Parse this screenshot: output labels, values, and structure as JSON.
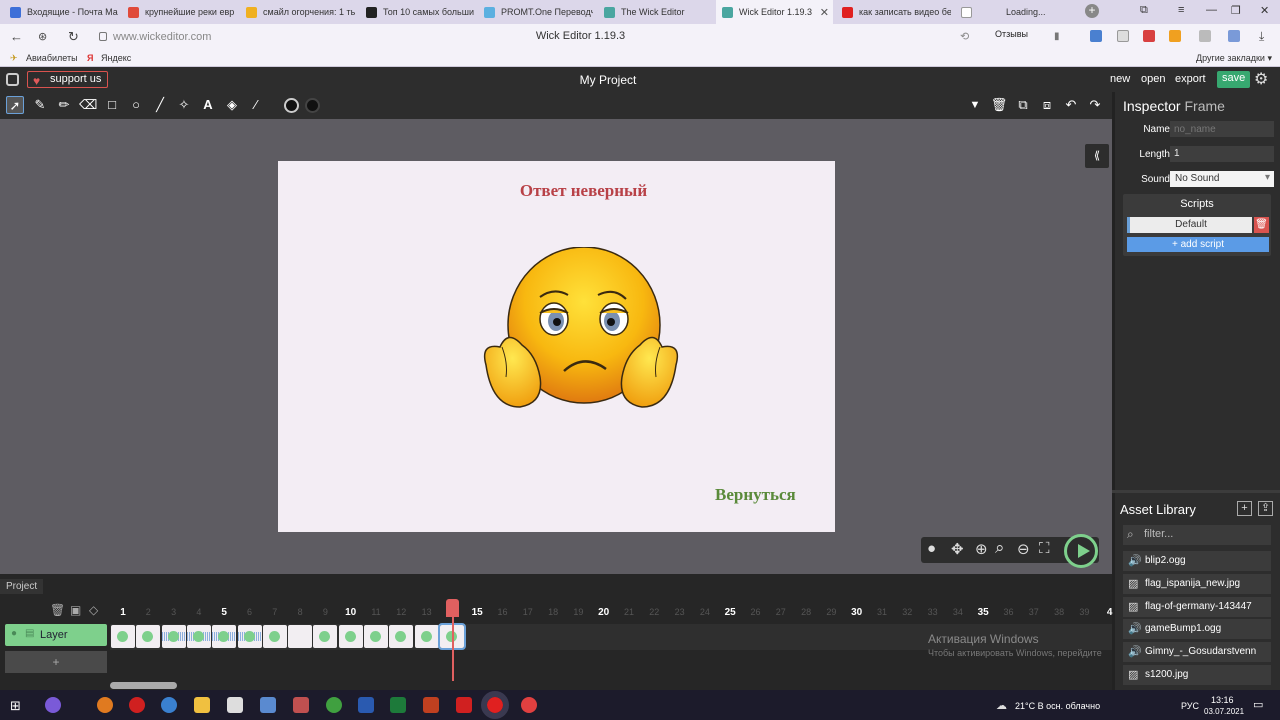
{
  "browser": {
    "tabs": [
      {
        "label": "Входящие - Почта Ма",
        "color": "#3d6fd8"
      },
      {
        "label": "крупнейшие реки евр",
        "color": "#e04a3a"
      },
      {
        "label": "смайл огорчения: 1 ты",
        "color": "#f0b020"
      },
      {
        "label": "Топ 10 самых больши",
        "color": "#222222"
      },
      {
        "label": "PROMT.One Переводч",
        "color": "#5bb0e0"
      },
      {
        "label": "The Wick Editor",
        "color": "#4aa6a0"
      },
      {
        "label": "Wick Editor 1.19.3",
        "color": "#4aa6a0"
      },
      {
        "label": "как записать видео бе",
        "color": "#e02020"
      },
      {
        "label": "Loading...",
        "color": "#ffffff"
      }
    ],
    "url": "www.wickeditor.com",
    "page_title": "Wick Editor 1.19.3",
    "reviews_label": "Отзывы",
    "bookmarks": [
      "Авиабилеты",
      "Яндекс"
    ],
    "other_bookmarks": "Другие закладки ▾"
  },
  "wick": {
    "support_label": "support us",
    "project_title": "My Project",
    "menu": {
      "new": "new",
      "open": "open",
      "export": "export",
      "save": "save"
    }
  },
  "stage": {
    "title": "Ответ неверный",
    "back_text": "Вернуться"
  },
  "inspector": {
    "title": "Inspector",
    "subtitle": "Frame",
    "name_label": "Name",
    "name_placeholder": "no_name",
    "length_label": "Length",
    "length_value": "1",
    "sound_label": "Sound",
    "sound_value": "No Sound",
    "scripts_title": "Scripts",
    "script_default": "Default",
    "add_script": "+ add script"
  },
  "assets": {
    "title": "Asset Library",
    "filter_placeholder": "filter...",
    "items": [
      {
        "name": "blip2.ogg",
        "type": "sound"
      },
      {
        "name": "flag_ispanija_new.jpg",
        "type": "image"
      },
      {
        "name": "flag-of-germany-143447",
        "type": "image"
      },
      {
        "name": "gameBump1.ogg",
        "type": "sound"
      },
      {
        "name": "Gimny_-_Gosudarstvenn",
        "type": "sound"
      },
      {
        "name": "s1200.jpg",
        "type": "image"
      }
    ]
  },
  "timeline": {
    "tab_label": "Project",
    "layer_name": "Layer",
    "add_layer": "+",
    "ruler_major": [
      "1",
      "5",
      "10",
      "15",
      "20",
      "25",
      "30",
      "35",
      "4"
    ],
    "ruler_minor": [
      "2",
      "3",
      "4",
      "6",
      "7",
      "8",
      "9",
      "11",
      "12",
      "13",
      "16",
      "17",
      "18",
      "19",
      "21",
      "22",
      "23",
      "24",
      "26",
      "27",
      "28",
      "29",
      "31",
      "32",
      "33",
      "34",
      "36",
      "37",
      "38",
      "39"
    ],
    "frame_count": 14,
    "current_frame": 14,
    "frames_with_sound": [
      3,
      4,
      5,
      6
    ],
    "empty_frames": [
      8
    ],
    "watermark": "Активация Windows",
    "watermark_sub": "Чтобы активировать Windows, перейдите"
  },
  "taskbar": {
    "weather": "21°C  В осн. облачно",
    "lang": "РУС",
    "time": "13:16",
    "date": "03.07.2021"
  }
}
